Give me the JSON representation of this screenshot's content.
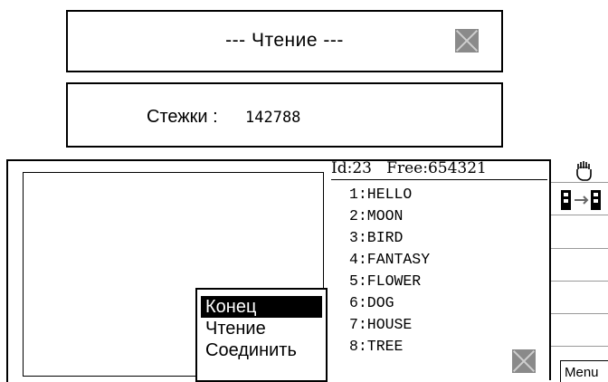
{
  "status": {
    "title": "--- Чтение ---",
    "icon": "cancel-stamp-icon"
  },
  "stitches": {
    "label": "Стежки :",
    "value": "142788"
  },
  "memory": {
    "id_line": "Id:23   Free:654321"
  },
  "patterns": [
    "1:HELLO",
    "2:MOON",
    "3:BIRD",
    "4:FANTASY",
    "5:FLOWER",
    "6:DOG",
    "7:HOUSE",
    "8:TREE"
  ],
  "popup_menu": {
    "items": [
      "Конец",
      "Чтение",
      "Соединить"
    ],
    "selected_index": 0
  },
  "side_panel": {
    "icons": [
      "hand-icon",
      "transfer-icon",
      "cancel-stamp-icon"
    ],
    "menu_label": "Menu"
  }
}
